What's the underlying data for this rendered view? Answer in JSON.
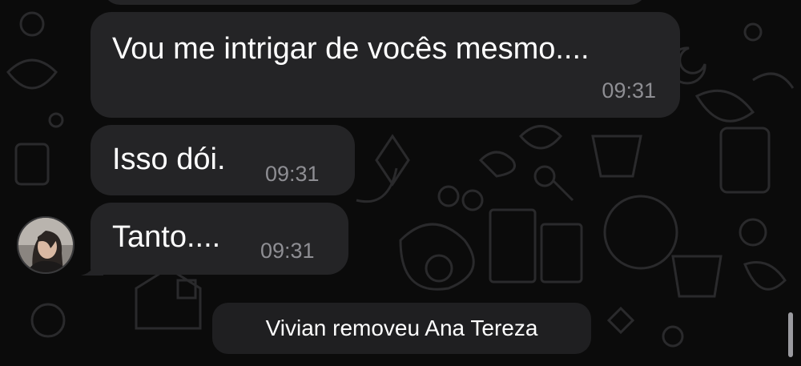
{
  "messages": [
    {
      "text": "Vou me intrigar de vocês mesmo....",
      "time": "09:31"
    },
    {
      "text": "Isso dói.",
      "time": "09:31"
    },
    {
      "text": "Tanto....",
      "time": "09:31"
    }
  ],
  "system_message": "Vivian removeu Ana Tereza",
  "colors": {
    "background": "#0b0b0b",
    "bubble": "#242426",
    "time_text": "#8e8e93",
    "doodle": "#2a2a2c"
  },
  "icons": {
    "avatar": "sender-avatar-photo",
    "wallpaper": "chat-doodle-pattern"
  }
}
